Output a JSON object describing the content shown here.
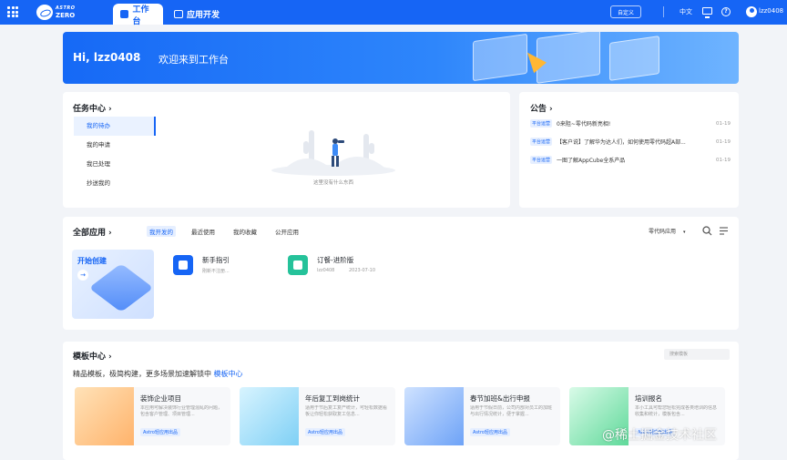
{
  "header": {
    "logo_line1": "ASTRO",
    "logo_line2": "ZERO",
    "tabs": [
      {
        "label": "工作台",
        "active": true
      },
      {
        "label": "应用开发",
        "active": false
      }
    ],
    "customize_label": "自定义",
    "language_label": "中文",
    "username": "lzz0408",
    "brand_color": "#1665f5"
  },
  "banner": {
    "greeting": "Hi, lzz0408",
    "welcome": "欢迎来到工作台"
  },
  "task_center": {
    "title": "任务中心",
    "nav": [
      {
        "label": "我的待办",
        "active": true
      },
      {
        "label": "我的申请",
        "active": false
      },
      {
        "label": "我已处理",
        "active": false
      },
      {
        "label": "抄送我的",
        "active": false
      }
    ],
    "empty_text": "这里没有什么东西"
  },
  "announcements": {
    "title": "公告",
    "items": [
      {
        "tag": "平台运营",
        "text": "0来阻~零代码新亮相!",
        "date": "01-19"
      },
      {
        "tag": "平台运营",
        "text": "【客户说】了解华为达人们，如何使用零代码超A部...",
        "date": "01-19"
      },
      {
        "tag": "平台运营",
        "text": "一图了解AppCube全系产品",
        "date": "01-19"
      }
    ]
  },
  "all_apps": {
    "title": "全部应用",
    "tabs": [
      {
        "label": "我开发的",
        "active": true
      },
      {
        "label": "最近使用",
        "active": false
      },
      {
        "label": "我的收藏",
        "active": false
      },
      {
        "label": "公开应用",
        "active": false
      }
    ],
    "filter_label": "零代码应用",
    "create_label": "开始创建",
    "apps": [
      {
        "name": "新手指引",
        "sub": "刚新不注册...",
        "color": "#1665f5"
      },
      {
        "name": "订餐-进阶版",
        "owner": "lzz0408",
        "date": "2023-07-10",
        "color": "#25c29a"
      }
    ]
  },
  "template_center": {
    "title": "模板中心",
    "search_placeholder": "搜索模板",
    "desc_prefix": "精品模板，极简构建，更多场景加速解锁中",
    "desc_link": "模板中心",
    "templates": [
      {
        "title": "装饰企业项目",
        "text": "本应用可解决装饰行业管理混乱的问题，包含客户管理、项目管理...",
        "badge": "Astro轻应用出品"
      },
      {
        "title": "年后复工到岗统计",
        "text": "适用于节后复工复产统计，可轻松数据看板让你轻松获取复工信息...",
        "badge": "Astro轻应用出品"
      },
      {
        "title": "春节加班&出行申报",
        "text": "适用于节假日前，公司内部对员工的加班与出行情况统计，便于掌握...",
        "badge": "Astro轻应用出品"
      },
      {
        "title": "培训报名",
        "text": "本小工具可帮您轻松完成各类培训的信息收集和统计，模板包含...",
        "badge": "Astro轻应用出品"
      }
    ]
  },
  "watermark": "@稀土掘金技术社区"
}
